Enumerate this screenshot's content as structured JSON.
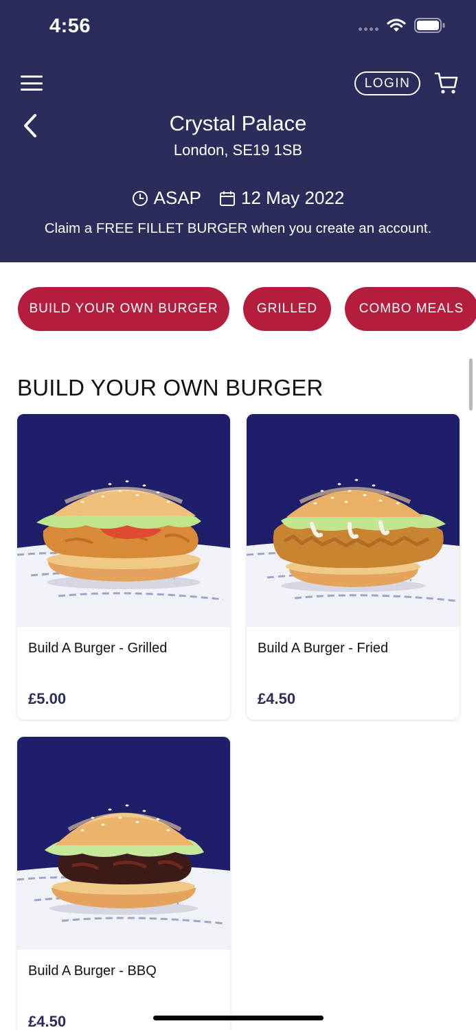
{
  "status_bar": {
    "time": "4:56",
    "icons": [
      "signal-icon",
      "wifi-icon",
      "battery-icon"
    ]
  },
  "header": {
    "menu_icon": "hamburger-menu-icon",
    "login_label": "LOGIN",
    "cart_icon": "cart-icon",
    "back_icon": "chevron-left-icon",
    "store_name": "Crystal Palace",
    "store_address": "London, SE19 1SB",
    "time_label": "ASAP",
    "date_label": "12 May 2022",
    "promo_text": "Claim a FREE FILLET BURGER when you create an account."
  },
  "categories": [
    {
      "label": "BUILD YOUR OWN BURGER"
    },
    {
      "label": "GRILLED"
    },
    {
      "label": "COMBO MEALS"
    }
  ],
  "section": {
    "title": "BUILD YOUR OWN BURGER"
  },
  "products": [
    {
      "name": "Build A Burger - Grilled",
      "price": "£5.00",
      "image": "grilled-burger-image"
    },
    {
      "name": "Build A Burger - Fried",
      "price": "£4.50",
      "image": "fried-burger-image"
    },
    {
      "name": "Build A Burger - BBQ",
      "price": "£4.50",
      "image": "bbq-burger-image"
    }
  ],
  "colors": {
    "header_bg": "#2b2b5c",
    "accent": "#b41e3c",
    "image_bg": "#1e1e6b",
    "price": "#2b2b5c"
  }
}
